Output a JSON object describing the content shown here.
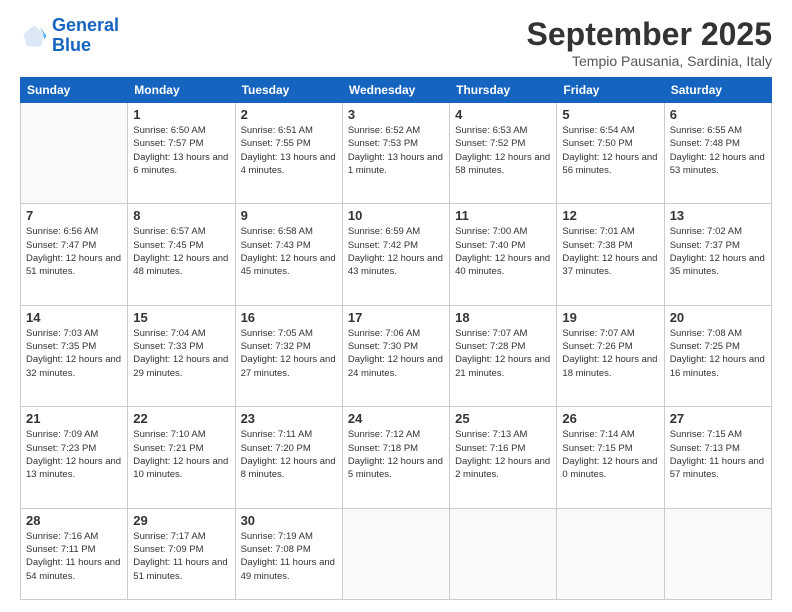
{
  "logo": {
    "line1": "General",
    "line2": "Blue"
  },
  "title": "September 2025",
  "subtitle": "Tempio Pausania, Sardinia, Italy",
  "headers": [
    "Sunday",
    "Monday",
    "Tuesday",
    "Wednesday",
    "Thursday",
    "Friday",
    "Saturday"
  ],
  "weeks": [
    [
      {
        "day": "",
        "sunrise": "",
        "sunset": "",
        "daylight": ""
      },
      {
        "day": "1",
        "sunrise": "Sunrise: 6:50 AM",
        "sunset": "Sunset: 7:57 PM",
        "daylight": "Daylight: 13 hours and 6 minutes."
      },
      {
        "day": "2",
        "sunrise": "Sunrise: 6:51 AM",
        "sunset": "Sunset: 7:55 PM",
        "daylight": "Daylight: 13 hours and 4 minutes."
      },
      {
        "day": "3",
        "sunrise": "Sunrise: 6:52 AM",
        "sunset": "Sunset: 7:53 PM",
        "daylight": "Daylight: 13 hours and 1 minute."
      },
      {
        "day": "4",
        "sunrise": "Sunrise: 6:53 AM",
        "sunset": "Sunset: 7:52 PM",
        "daylight": "Daylight: 12 hours and 58 minutes."
      },
      {
        "day": "5",
        "sunrise": "Sunrise: 6:54 AM",
        "sunset": "Sunset: 7:50 PM",
        "daylight": "Daylight: 12 hours and 56 minutes."
      },
      {
        "day": "6",
        "sunrise": "Sunrise: 6:55 AM",
        "sunset": "Sunset: 7:48 PM",
        "daylight": "Daylight: 12 hours and 53 minutes."
      }
    ],
    [
      {
        "day": "7",
        "sunrise": "Sunrise: 6:56 AM",
        "sunset": "Sunset: 7:47 PM",
        "daylight": "Daylight: 12 hours and 51 minutes."
      },
      {
        "day": "8",
        "sunrise": "Sunrise: 6:57 AM",
        "sunset": "Sunset: 7:45 PM",
        "daylight": "Daylight: 12 hours and 48 minutes."
      },
      {
        "day": "9",
        "sunrise": "Sunrise: 6:58 AM",
        "sunset": "Sunset: 7:43 PM",
        "daylight": "Daylight: 12 hours and 45 minutes."
      },
      {
        "day": "10",
        "sunrise": "Sunrise: 6:59 AM",
        "sunset": "Sunset: 7:42 PM",
        "daylight": "Daylight: 12 hours and 43 minutes."
      },
      {
        "day": "11",
        "sunrise": "Sunrise: 7:00 AM",
        "sunset": "Sunset: 7:40 PM",
        "daylight": "Daylight: 12 hours and 40 minutes."
      },
      {
        "day": "12",
        "sunrise": "Sunrise: 7:01 AM",
        "sunset": "Sunset: 7:38 PM",
        "daylight": "Daylight: 12 hours and 37 minutes."
      },
      {
        "day": "13",
        "sunrise": "Sunrise: 7:02 AM",
        "sunset": "Sunset: 7:37 PM",
        "daylight": "Daylight: 12 hours and 35 minutes."
      }
    ],
    [
      {
        "day": "14",
        "sunrise": "Sunrise: 7:03 AM",
        "sunset": "Sunset: 7:35 PM",
        "daylight": "Daylight: 12 hours and 32 minutes."
      },
      {
        "day": "15",
        "sunrise": "Sunrise: 7:04 AM",
        "sunset": "Sunset: 7:33 PM",
        "daylight": "Daylight: 12 hours and 29 minutes."
      },
      {
        "day": "16",
        "sunrise": "Sunrise: 7:05 AM",
        "sunset": "Sunset: 7:32 PM",
        "daylight": "Daylight: 12 hours and 27 minutes."
      },
      {
        "day": "17",
        "sunrise": "Sunrise: 7:06 AM",
        "sunset": "Sunset: 7:30 PM",
        "daylight": "Daylight: 12 hours and 24 minutes."
      },
      {
        "day": "18",
        "sunrise": "Sunrise: 7:07 AM",
        "sunset": "Sunset: 7:28 PM",
        "daylight": "Daylight: 12 hours and 21 minutes."
      },
      {
        "day": "19",
        "sunrise": "Sunrise: 7:07 AM",
        "sunset": "Sunset: 7:26 PM",
        "daylight": "Daylight: 12 hours and 18 minutes."
      },
      {
        "day": "20",
        "sunrise": "Sunrise: 7:08 AM",
        "sunset": "Sunset: 7:25 PM",
        "daylight": "Daylight: 12 hours and 16 minutes."
      }
    ],
    [
      {
        "day": "21",
        "sunrise": "Sunrise: 7:09 AM",
        "sunset": "Sunset: 7:23 PM",
        "daylight": "Daylight: 12 hours and 13 minutes."
      },
      {
        "day": "22",
        "sunrise": "Sunrise: 7:10 AM",
        "sunset": "Sunset: 7:21 PM",
        "daylight": "Daylight: 12 hours and 10 minutes."
      },
      {
        "day": "23",
        "sunrise": "Sunrise: 7:11 AM",
        "sunset": "Sunset: 7:20 PM",
        "daylight": "Daylight: 12 hours and 8 minutes."
      },
      {
        "day": "24",
        "sunrise": "Sunrise: 7:12 AM",
        "sunset": "Sunset: 7:18 PM",
        "daylight": "Daylight: 12 hours and 5 minutes."
      },
      {
        "day": "25",
        "sunrise": "Sunrise: 7:13 AM",
        "sunset": "Sunset: 7:16 PM",
        "daylight": "Daylight: 12 hours and 2 minutes."
      },
      {
        "day": "26",
        "sunrise": "Sunrise: 7:14 AM",
        "sunset": "Sunset: 7:15 PM",
        "daylight": "Daylight: 12 hours and 0 minutes."
      },
      {
        "day": "27",
        "sunrise": "Sunrise: 7:15 AM",
        "sunset": "Sunset: 7:13 PM",
        "daylight": "Daylight: 11 hours and 57 minutes."
      }
    ],
    [
      {
        "day": "28",
        "sunrise": "Sunrise: 7:16 AM",
        "sunset": "Sunset: 7:11 PM",
        "daylight": "Daylight: 11 hours and 54 minutes."
      },
      {
        "day": "29",
        "sunrise": "Sunrise: 7:17 AM",
        "sunset": "Sunset: 7:09 PM",
        "daylight": "Daylight: 11 hours and 51 minutes."
      },
      {
        "day": "30",
        "sunrise": "Sunrise: 7:19 AM",
        "sunset": "Sunset: 7:08 PM",
        "daylight": "Daylight: 11 hours and 49 minutes."
      },
      {
        "day": "",
        "sunrise": "",
        "sunset": "",
        "daylight": ""
      },
      {
        "day": "",
        "sunrise": "",
        "sunset": "",
        "daylight": ""
      },
      {
        "day": "",
        "sunrise": "",
        "sunset": "",
        "daylight": ""
      },
      {
        "day": "",
        "sunrise": "",
        "sunset": "",
        "daylight": ""
      }
    ]
  ]
}
